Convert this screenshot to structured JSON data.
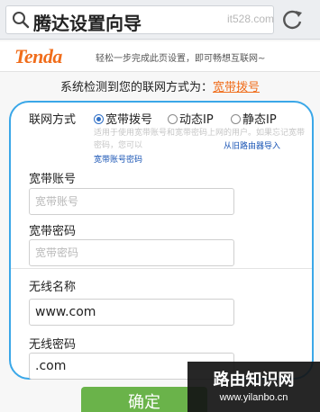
{
  "browser": {
    "search_text": "腾达设置向导",
    "watermark": "it528.com"
  },
  "brand": {
    "logo": "Tenda",
    "slogan": "轻松一步完成此页设置，即可畅想互联网~"
  },
  "detect": {
    "text": "系统检测到您的联网方式为：",
    "value": "宽带拨号"
  },
  "form": {
    "connection_label": "联网方式",
    "options": [
      "宽带拨号",
      "动态IP",
      "静态IP"
    ],
    "selected": 0,
    "hint": "适用于使用宽带账号和宽带密码上网的用户。如果忘记宽带密码，您可以",
    "import_link": "从旧路由器导入",
    "import_link2": "宽带账号密码",
    "account_label": "宽带账号",
    "account_placeholder": "宽带账号",
    "password_label": "宽带密码",
    "password_placeholder": "宽带密码",
    "ssid_label": "无线名称",
    "ssid_value": "www.com",
    "wifi_password_label": "无线密码",
    "wifi_password_value": ".com"
  },
  "confirm_label": "确定",
  "overlay": {
    "title": "路由知识网",
    "url": "www.yilanbo.cn"
  }
}
